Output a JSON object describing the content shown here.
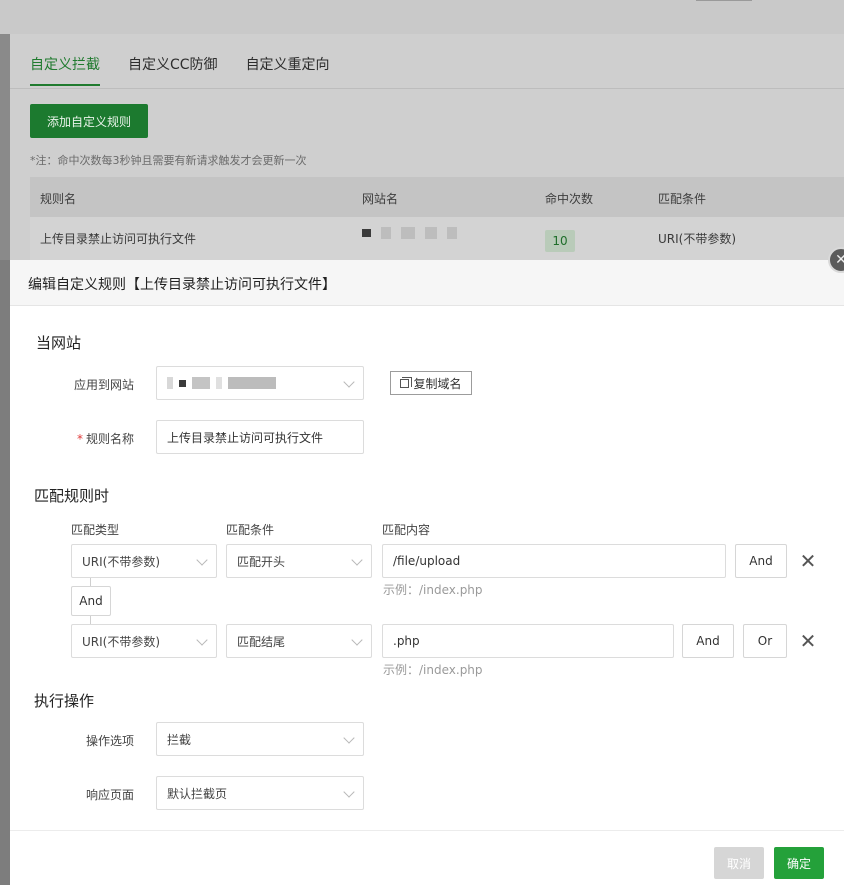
{
  "background": {
    "tabs": [
      "自定义拦截",
      "自定义CC防御",
      "自定义重定向"
    ],
    "add_button": "添加自定义规则",
    "note": "*注：命中次数每3秒钟且需要有新请求触发才会更新一次",
    "table": {
      "headers": [
        "规则名",
        "网站名",
        "命中次数",
        "匹配条件"
      ],
      "row": {
        "rule_name": "上传目录禁止访问可执行文件",
        "hits": "10",
        "condition": "URI(不带参数)"
      }
    }
  },
  "modal": {
    "title": "编辑自定义规则【上传目录禁止访问可执行文件】",
    "site_section": {
      "title": "当网站",
      "apply_label": "应用到网站",
      "copy_button": "复制域名",
      "rule_name_label": "规则名称",
      "rule_name_value": "上传目录禁止访问可执行文件"
    },
    "match_section": {
      "title": "匹配规则时",
      "col_type": "匹配类型",
      "col_condition": "匹配条件",
      "col_content": "匹配内容",
      "rows": [
        {
          "type": "URI(不带参数)",
          "condition": "匹配开头",
          "content": "/file/upload",
          "hint": "示例：/index.php",
          "and": "And"
        },
        {
          "type": "URI(不带参数)",
          "condition": "匹配结尾",
          "content": ".php",
          "hint": "示例：/index.php",
          "and": "And",
          "or": "Or"
        }
      ],
      "connector": "And"
    },
    "action_section": {
      "title": "执行操作",
      "option_label": "操作选项",
      "option_value": "拦截",
      "response_label": "响应页面",
      "response_value": "默认拦截页"
    },
    "footer": {
      "cancel": "取消",
      "confirm": "确定"
    }
  },
  "colors": {
    "accent": "#24a13a",
    "tab_active": "#1f7a2e"
  }
}
